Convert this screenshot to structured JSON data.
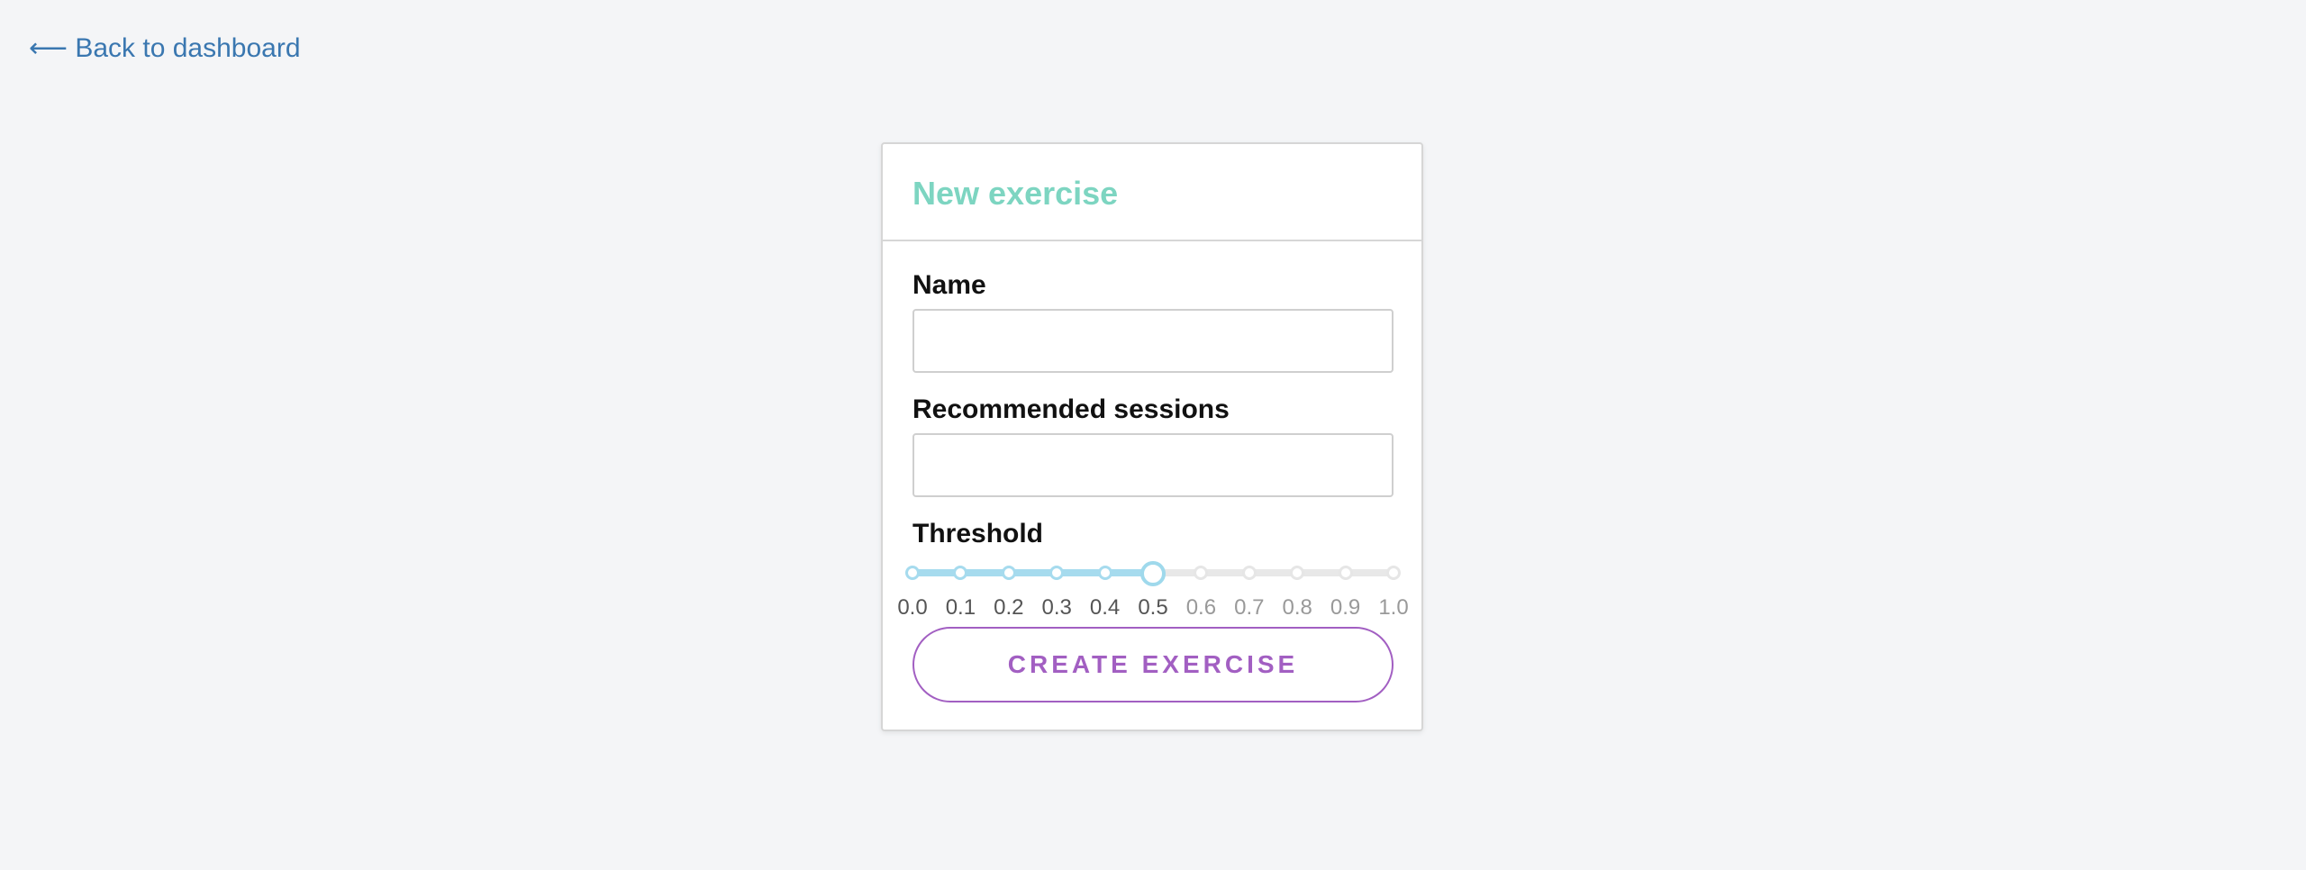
{
  "nav": {
    "back_link": "⟵ Back to dashboard"
  },
  "form": {
    "title": "New exercise",
    "name": {
      "label": "Name",
      "value": "",
      "placeholder": ""
    },
    "sessions": {
      "label": "Recommended sessions",
      "value": "",
      "placeholder": ""
    },
    "threshold": {
      "label": "Threshold",
      "min": 0.0,
      "max": 1.0,
      "step": 0.1,
      "value": 0.5,
      "marks": [
        "0.0",
        "0.1",
        "0.2",
        "0.3",
        "0.4",
        "0.5",
        "0.6",
        "0.7",
        "0.8",
        "0.9",
        "1.0"
      ]
    },
    "submit_label": "CREATE EXERCISE"
  },
  "colors": {
    "background": "#f4f5f7",
    "link": "#3a77b0",
    "title": "#7dd5c1",
    "slider_active": "#a6dbee",
    "slider_inactive": "#e8e8e8",
    "button": "#a25fc2"
  }
}
